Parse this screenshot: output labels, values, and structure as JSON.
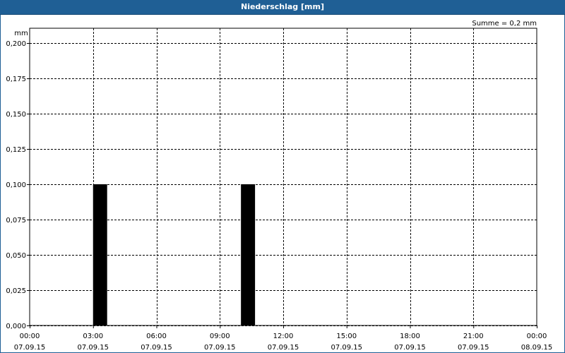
{
  "header": {
    "title": "Niederschlag [mm]"
  },
  "sum_label": "Summe = 0,2 mm",
  "chart_data": {
    "type": "bar",
    "title": "Niederschlag [mm]",
    "ylabel": "mm",
    "ylim": [
      0,
      0.2
    ],
    "yticks": [
      "0,000",
      "0,025",
      "0,050",
      "0,075",
      "0,100",
      "0,125",
      "0,150",
      "0,175",
      "0,200"
    ],
    "xlim_hours": [
      0,
      24
    ],
    "xticks": [
      {
        "time": "00:00",
        "date": "07.09.15"
      },
      {
        "time": "03:00",
        "date": "07.09.15"
      },
      {
        "time": "06:00",
        "date": "07.09.15"
      },
      {
        "time": "09:00",
        "date": "07.09.15"
      },
      {
        "time": "12:00",
        "date": "07.09.15"
      },
      {
        "time": "15:00",
        "date": "07.09.15"
      },
      {
        "time": "18:00",
        "date": "07.09.15"
      },
      {
        "time": "21:00",
        "date": "07.09.15"
      },
      {
        "time": "00:00",
        "date": "08.09.15"
      }
    ],
    "bars": [
      {
        "start": "07.09.15 03:00",
        "end": "07.09.15 03:40",
        "value": 0.1
      },
      {
        "start": "07.09.15 10:00",
        "end": "07.09.15 10:40",
        "value": 0.1
      }
    ],
    "grid": true,
    "colors": {
      "bar": "#000000",
      "grid": "#000000"
    }
  }
}
